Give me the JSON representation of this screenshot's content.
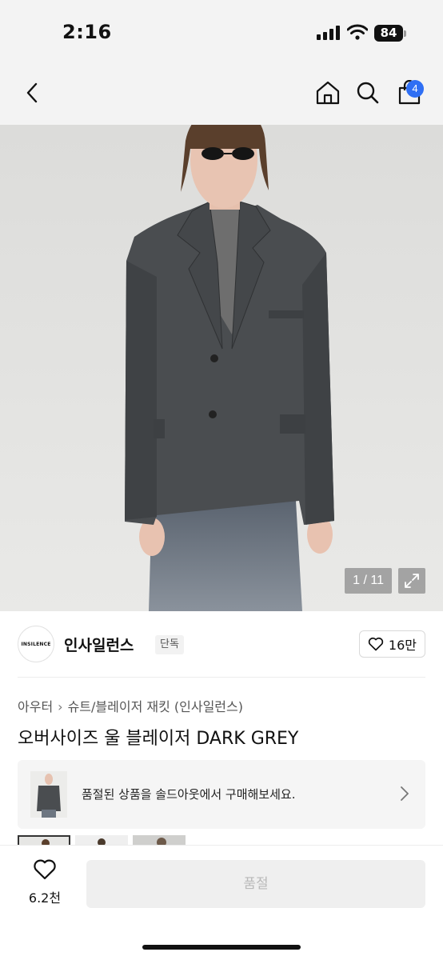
{
  "status": {
    "time": "2:16",
    "battery": "84"
  },
  "header": {
    "cart_count": "4"
  },
  "gallery": {
    "counter": "1 / 11"
  },
  "brand": {
    "logo_text": "INSILENCE",
    "name": "인사일런스",
    "tag": "단독",
    "likes": "16만"
  },
  "category": {
    "parent": "아우터",
    "child": "슈트/블레이저 재킷 (인사일런스)"
  },
  "product": {
    "title": "오버사이즈 울 블레이저 DARK GREY"
  },
  "soldout": {
    "message": "품절된 상품을 솔드아웃에서 구매해보세요."
  },
  "bottom": {
    "wish_count": "6.2천",
    "buy_label": "품절"
  },
  "icons": [
    "back-icon",
    "home-icon",
    "search-icon",
    "cart-icon",
    "expand-icon",
    "heart-icon",
    "chevron-right-icon"
  ],
  "colors": {
    "accent": "#2f6ff4",
    "jacket": "#4a4d50",
    "disabled_button": "#efefef"
  }
}
